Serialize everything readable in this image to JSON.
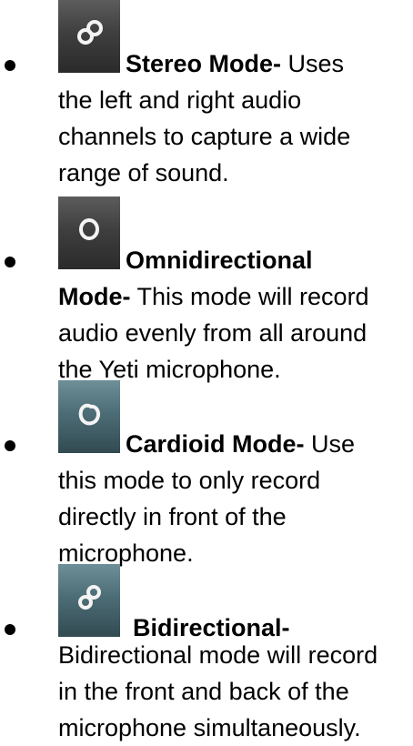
{
  "items": [
    {
      "icon": "stereo-mode-icon",
      "title": "Stereo Mode-",
      "first_line_rest": " Uses",
      "lines": [
        "the left and right audio",
        "channels to capture a wide",
        "range of sound."
      ]
    },
    {
      "icon": "omnidirectional-mode-icon",
      "title": "Omnidirectional",
      "first_line_rest": "",
      "title_cont": "Mode-",
      "second_line_rest": " This mode will record",
      "lines": [
        "audio evenly from all around",
        "the Yeti microphone."
      ]
    },
    {
      "icon": "cardioid-mode-icon",
      "title": "Cardioid Mode-",
      "first_line_rest": " Use",
      "lines": [
        "this mode to only record",
        "directly in front of the",
        "microphone."
      ]
    },
    {
      "icon": "bidirectional-mode-icon",
      "title": "Bidirectional-",
      "first_line_rest": "",
      "lines": [
        "Bidirectional mode will record",
        "in the front and back of the",
        "microphone simultaneously."
      ]
    }
  ]
}
